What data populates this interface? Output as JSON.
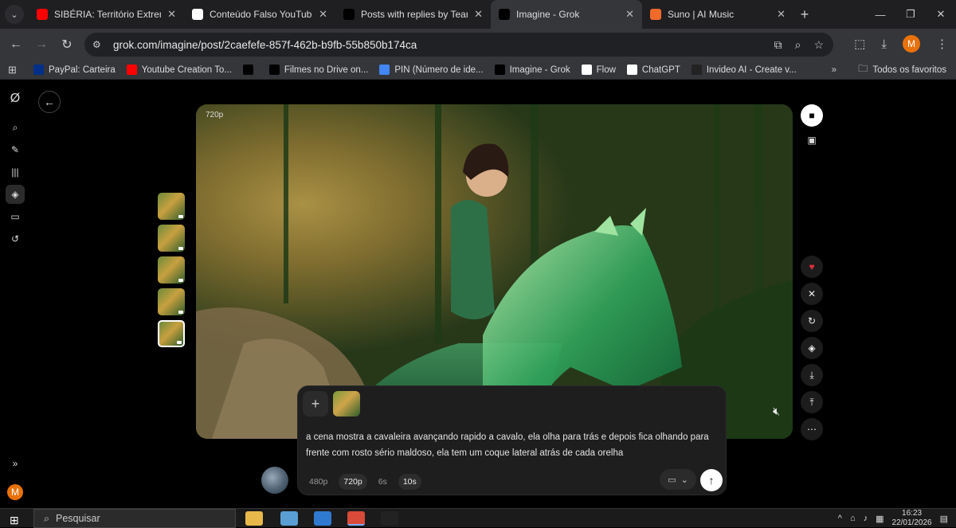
{
  "tabs": [
    {
      "title": "SIBÉRIA: Território Extremo [D",
      "favicon": "youtube-icon",
      "color": "#ff0000"
    },
    {
      "title": "Conteúdo Falso YouTube",
      "favicon": "chatgpt-icon",
      "color": "#ffffff"
    },
    {
      "title": "Posts with replies by TeamYo",
      "favicon": "x-icon",
      "color": "#000000"
    },
    {
      "title": "Imagine - Grok",
      "favicon": "grok-icon",
      "color": "#000000",
      "active": true
    },
    {
      "title": "Suno | AI Music",
      "favicon": "suno-icon",
      "color": "#f06a2a"
    }
  ],
  "address_bar": {
    "url": "grok.com/imagine/post/2caefefe-857f-462b-b9fb-55b850b174ca"
  },
  "profile_initial": "M",
  "bookmarks": [
    {
      "label": "PayPal: Carteira",
      "icon": "paypal-icon",
      "color": "#003087"
    },
    {
      "label": "Youtube Creation To...",
      "icon": "youtube-icon",
      "color": "#ff0000"
    },
    {
      "label": "",
      "icon": "grok-icon",
      "color": "#000000"
    },
    {
      "label": "Filmes no Drive on...",
      "icon": "x-icon",
      "color": "#000000"
    },
    {
      "label": "PIN (Número de ide...",
      "icon": "google-icon",
      "color": "#4285f4"
    },
    {
      "label": "Imagine - Grok",
      "icon": "grok-icon",
      "color": "#000000"
    },
    {
      "label": "Flow",
      "icon": "flow-icon",
      "color": "#ffffff"
    },
    {
      "label": "ChatGPT",
      "icon": "chatgpt-icon",
      "color": "#ffffff"
    },
    {
      "label": "Invideo AI - Create v...",
      "icon": "invideo-icon",
      "color": "#222222"
    }
  ],
  "all_bookmarks_label": "Todos os favoritos",
  "viewer": {
    "resolution_badge": "720p"
  },
  "prompt": {
    "text": "a cena mostra a cavaleira avançando rapido a cavalo, ela olha para trás e depois fica olhando para frente com rosto sério maldoso, ela tem um coque lateral atrás de cada orelha",
    "resolutions": [
      "480p",
      "720p"
    ],
    "selected_resolution": "720p",
    "durations": [
      "6s",
      "10s"
    ],
    "selected_duration": "10s"
  },
  "sidebar_user_initial": "M",
  "taskbar": {
    "search_placeholder": "Pesquisar",
    "time": "16:23",
    "date": "22/01/2026"
  },
  "colors": {
    "accent_like": "#e0303c",
    "brand_orange": "#e8710a"
  }
}
